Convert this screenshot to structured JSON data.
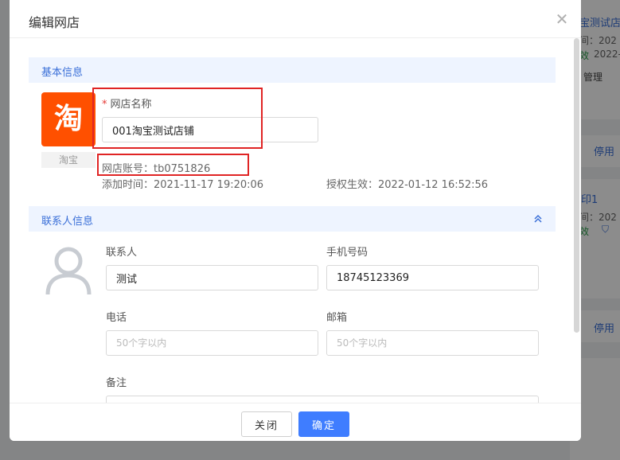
{
  "background": {
    "card1_title": "宝测试店",
    "card1_time": "间：202",
    "card1_status": "效",
    "card1_date": "2022-0",
    "card1_manage": "管理",
    "card1_action": "停用",
    "card2_title": "印1",
    "card2_time": "间：202",
    "card2_status": "效",
    "card2_action": "停用"
  },
  "dialog": {
    "title": "编辑网店",
    "close_symbol": "✕"
  },
  "basic_info": {
    "section_title": "基本信息",
    "logo_text": "淘",
    "logo_caption": "淘宝",
    "required_mark": "*",
    "shop_name_label": "网店名称",
    "shop_name_value": "001淘宝测试店铺",
    "account_line": "网店账号：tb0751826",
    "added_time_line": "添加时间：2021-11-17 19:20:06",
    "auth_line": "授权生效：2022-01-12 16:52:56"
  },
  "contact_info": {
    "section_title": "联系人信息",
    "contact_label": "联系人",
    "contact_value": "测试",
    "mobile_label": "手机号码",
    "mobile_value": "18745123369",
    "phone_label": "电话",
    "phone_placeholder": "50个字以内",
    "email_label": "邮箱",
    "email_placeholder": "50个字以内",
    "remark_label": "备注"
  },
  "footer": {
    "close_label": "关闭",
    "confirm_label": "确定"
  },
  "colors": {
    "accent": "#3f7dff",
    "section_bg": "#eef4ff",
    "taobao_orange": "#ff5000",
    "highlight_red": "#e02424"
  }
}
